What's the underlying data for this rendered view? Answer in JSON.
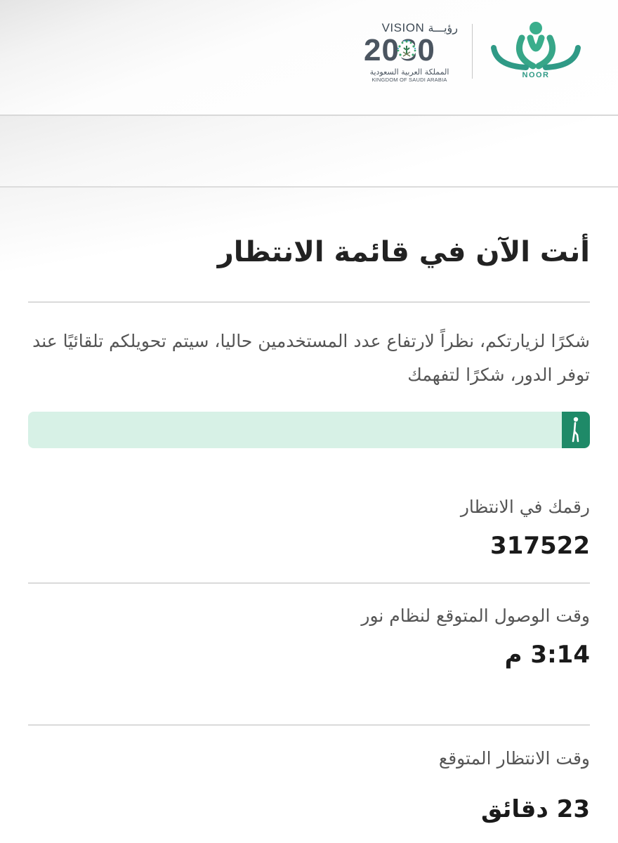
{
  "header": {
    "vision_label": "VISION",
    "vision_ar": "رؤيـــة",
    "vision_year": "2030",
    "kingdom_ar": "المملكة العربية السعودية",
    "kingdom_en": "KINGDOM OF SAUDI ARABIA",
    "noor_label": "NOOR",
    "noor_color": "#2f9a86"
  },
  "queue": {
    "title": "أنت الآن في قائمة الانتظار",
    "message": "شكرًا لزيارتكم، نظراً لارتفاع عدد المستخدمين حاليا، سيتم تحويلكم تلقائيًا عند توفر الدور، شكرًا لتفهمك",
    "progress_fraction": 0.05,
    "progress_color": "#1f8a68",
    "progress_track_color": "#d7f1e6",
    "progress_icon": "walking-person-icon"
  },
  "details": {
    "number_label": "رقمك في الانتظار",
    "number_value": "317522",
    "arrival_label": "وقت الوصول المتوقع لنظام نور",
    "arrival_value": "3:14 م",
    "wait_label": "وقت الانتظار المتوقع",
    "wait_value": "23 دقائق"
  }
}
